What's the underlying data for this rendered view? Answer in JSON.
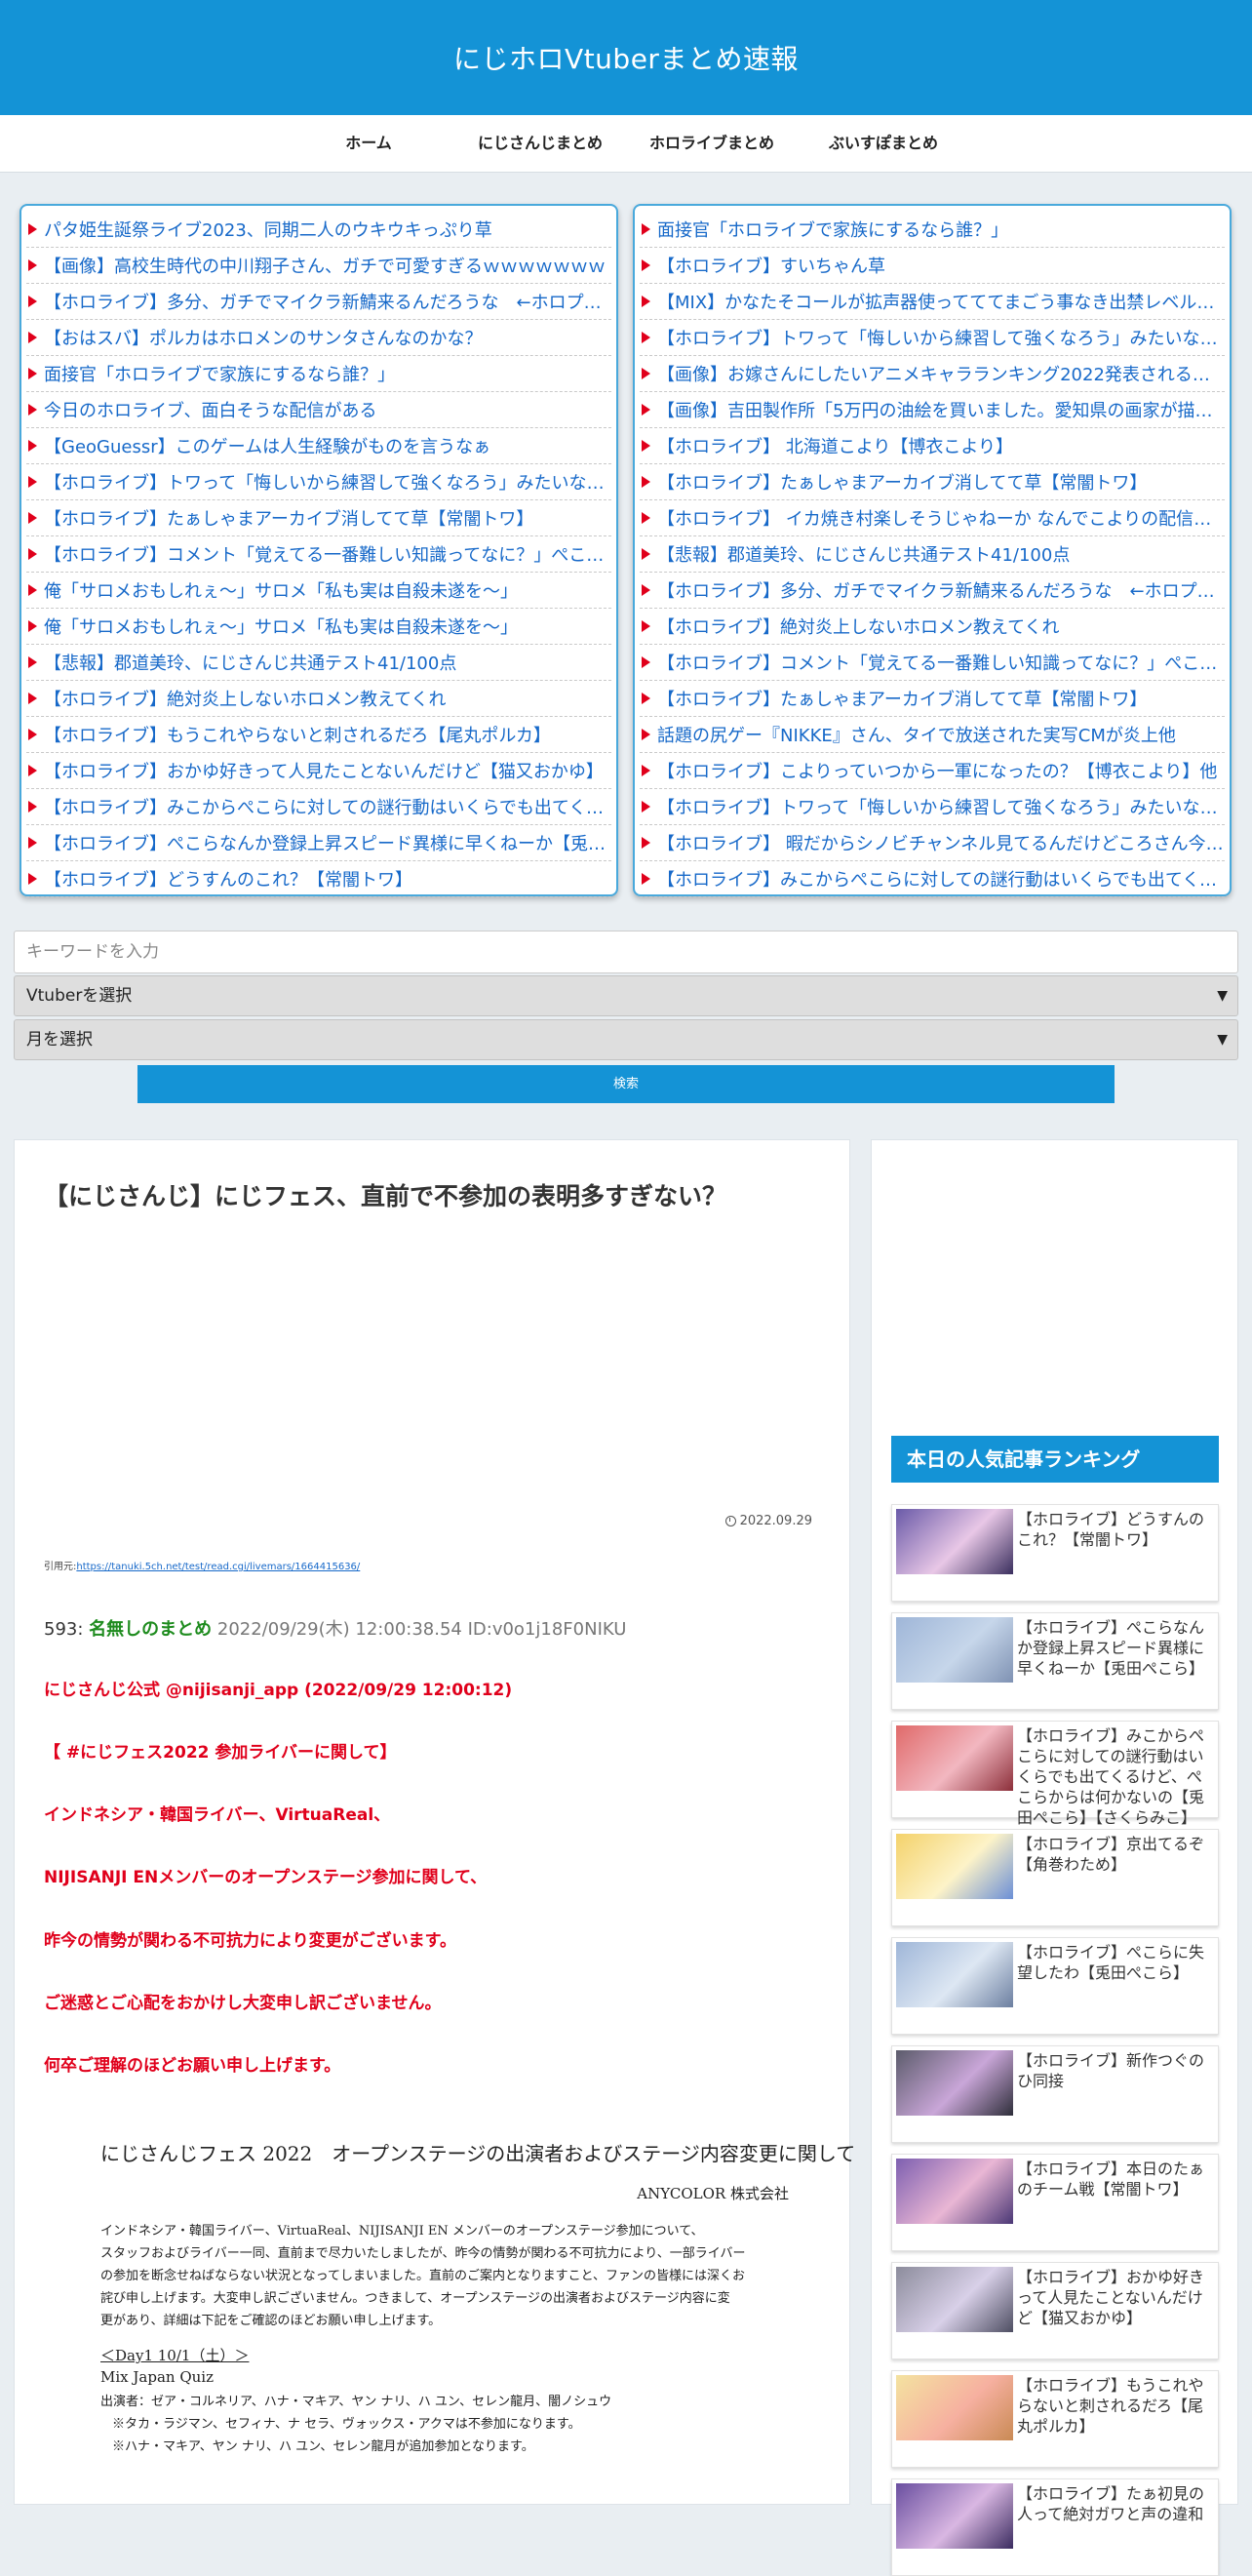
{
  "site": {
    "title": "にじホロVtuberまとめ速報"
  },
  "nav": [
    "ホーム",
    "にじさんじまとめ",
    "ホロライブまとめ",
    "ぶいすぽまとめ"
  ],
  "feed_left": [
    "パタ姫生誕祭ライブ2023、同期二人のウキウキっぷり草",
    "【画像】高校生時代の中川翔子さん、ガチで可愛すぎるｗｗｗｗｗｗｗ",
    "【ホロライブ】多分、ガチでマイクラ新鯖来るんだろうな　←ホロプロ…",
    "【おはスバ】ポルカはホロメンのサンタさんなのかな？",
    "面接官「ホロライブで家族にするなら誰？」",
    "今日のホロライブ、面白そうな配信がある",
    "【GeoGuessr】このゲームは人生経験がものを言うなぁ",
    "【ホロライブ】トワって「悔しいから練習して強くなろう」みたいな感…",
    "【ホロライブ】たぁしゃまアーカイブ消してて草【常闇トワ】",
    "【ホロライブ】コメント「覚えてる一番難しい知識ってなに？」ぺこら…",
    "俺「サロメおもしれぇ～」サロメ「私も実は自殺未遂を～」",
    "俺「サロメおもしれぇ～」サロメ「私も実は自殺未遂を～」",
    "【悲報】郡道美玲、にじさんじ共通テスト41/100点",
    "【ホロライブ】絶対炎上しないホロメン教えてくれ",
    "【ホロライブ】もうこれやらないと刺されるだろ【尾丸ポルカ】",
    "【ホロライブ】おかゆ好きって人見たことないんだけど【猫又おかゆ】",
    "【ホロライブ】みこからぺこらに対しての謎行動はいくらでも出てくる…",
    "【ホロライブ】ぺこらなんか登録上昇スピード異様に早くねーか【兎田…",
    "【ホロライブ】どうすんのこれ？【常闇トワ】"
  ],
  "feed_right": [
    "面接官「ホロライブで家族にするなら誰？」",
    "【ホロライブ】すいちゃん草",
    "【MIX】かなたそコールが拡声器使ってててまごう事なき出禁レベルのう…",
    "【ホロライブ】トワって「悔しいから練習して強くなろう」みたいな感…",
    "【画像】お嫁さんにしたいアニメキャラランキング2022発表されるｗ…",
    "【画像】吉田製作所「5万円の油絵を買いました。愛知県の画家が描い…",
    "【ホロライブ】 北海道こより【博衣こより】",
    "【ホロライブ】たぁしゃまアーカイブ消してて草【常闇トワ】",
    "【ホロライブ】 イカ焼き村楽しそうじゃねーか なんでこよりの配信見…",
    "【悲報】郡道美玲、にじさんじ共通テスト41/100点",
    "【ホロライブ】多分、ガチでマイクラ新鯖来るんだろうな　←ホロプロ…",
    "【ホロライブ】絶対炎上しないホロメン教えてくれ",
    "【ホロライブ】コメント「覚えてる一番難しい知識ってなに？」ぺこら…",
    "【ホロライブ】たぁしゃまアーカイブ消してて草【常闇トワ】",
    "話題の尻ゲー『NIKKE』さん、タイで放送された実写CMが炎上他",
    "【ホロライブ】こよりっていつから一軍になったの？【博衣こより】他",
    "【ホロライブ】トワって「悔しいから練習して強くなろう」みたいな感…",
    "【ホロライブ】 暇だからシノビチャンネル見てるんだけどころさん今…",
    "【ホロライブ】みこからぺこらに対しての謎行動はいくらでも出てくる…"
  ],
  "search": {
    "placeholder": "キーワードを入力",
    "vtuber_select": "Vtuberを選択",
    "month_select": "月を選択",
    "button": "検索"
  },
  "article": {
    "title": "【にじさんじ】にじフェス、直前で不参加の表明多すぎない？",
    "date": "2022.09.29",
    "source_label": "引用元:",
    "source_url": "https://tanuki.5ch.net/test/read.cgi/livemars/1664415636/",
    "post_number": "593:",
    "post_name": "名無しのまとめ",
    "post_meta": "2022/09/29(木) 12:00:38.54 ID:v0o1j18F0NIKU",
    "red_lines": [
      "にじさんじ公式 @nijisanji_app (2022/09/29 12:00:12)",
      "【 #にじフェス2022 参加ライバーに関して】",
      "インドネシア・韓国ライバー、VirtuaReal、",
      "NIJISANJI ENメンバーのオープンステージ参加に関して、",
      "昨今の情勢が関わる不可抗力により変更がございます。",
      "ご迷惑とご心配をおかけし大変申し訳ございません。",
      "何卒ご理解のほどお願い申し上げます。"
    ],
    "notice": {
      "title": "にじさんじフェス 2022　オープンステージの出演者およびステージ内容変更に関して",
      "company": "ANYCOLOR 株式会社",
      "body": [
        "インドネシア・韓国ライバー、VirtuaReal、NIJISANJI EN メンバーのオープンステージ参加について、",
        "スタッフおよびライバー一同、直前まで尽力いたしましたが、昨今の情勢が関わる不可抗力により、一部ライバー",
        "の参加を断念せねばならない状況となってしまいました。直前のご案内となりますこと、ファンの皆様には深くお",
        "詫び申し上げます。大変申し訳ございません。つきまして、オープンステージの出演者およびステージ内容に変",
        "更があり、詳細は下記をご確認のほどお願い申し上げます。"
      ],
      "day": "＜Day1  10/1（土）＞",
      "event": "Mix Japan Quiz",
      "performers": "出演者：ゼア・コルネリア、ハナ・マキア、ヤン ナリ、ハ ユン、セレン龍月、闇ノシュウ",
      "note1": "※タカ・ラジマン、セフィナ、ナ セラ、ヴォックス・アクマは不参加になります。",
      "note2": "※ハナ・マキア、ヤン ナリ、ハ ユン、セレン龍月が追加参加となります。"
    }
  },
  "sidebar": {
    "ranking_title": "本日の人気記事ランキング",
    "items": [
      "【ホロライブ】どうすんのこれ？【常闇トワ】",
      "【ホロライブ】ぺこらなんか登録上昇スピード異様に早くねーか【兎田ぺこら】",
      "【ホロライブ】みこからぺこらに対しての謎行動はいくらでも出てくるけど、ぺこらからは何かないの【兎田ぺこら】【さくらみこ】",
      "【ホロライブ】京出てるぞ【角巻わため】",
      "【ホロライブ】ぺこらに失望したわ【兎田ぺこら】",
      "【ホロライブ】新作つぐのひ同接",
      "【ホロライブ】本日のたぁのチーム戦【常闇トワ】",
      "【ホロライブ】おかゆ好きって人見たことないんだけど【猫又おかゆ】",
      "【ホロライブ】もうこれやらないと刺されるだろ【尾丸ポルカ】",
      "【ホロライブ】たぁ初見の人って絶対ガワと声の違和"
    ]
  },
  "colors": {
    "brand": "#1493d6",
    "link": "#1769c9",
    "accent_red": "#e0001b",
    "name_green": "#1f8c1f"
  }
}
